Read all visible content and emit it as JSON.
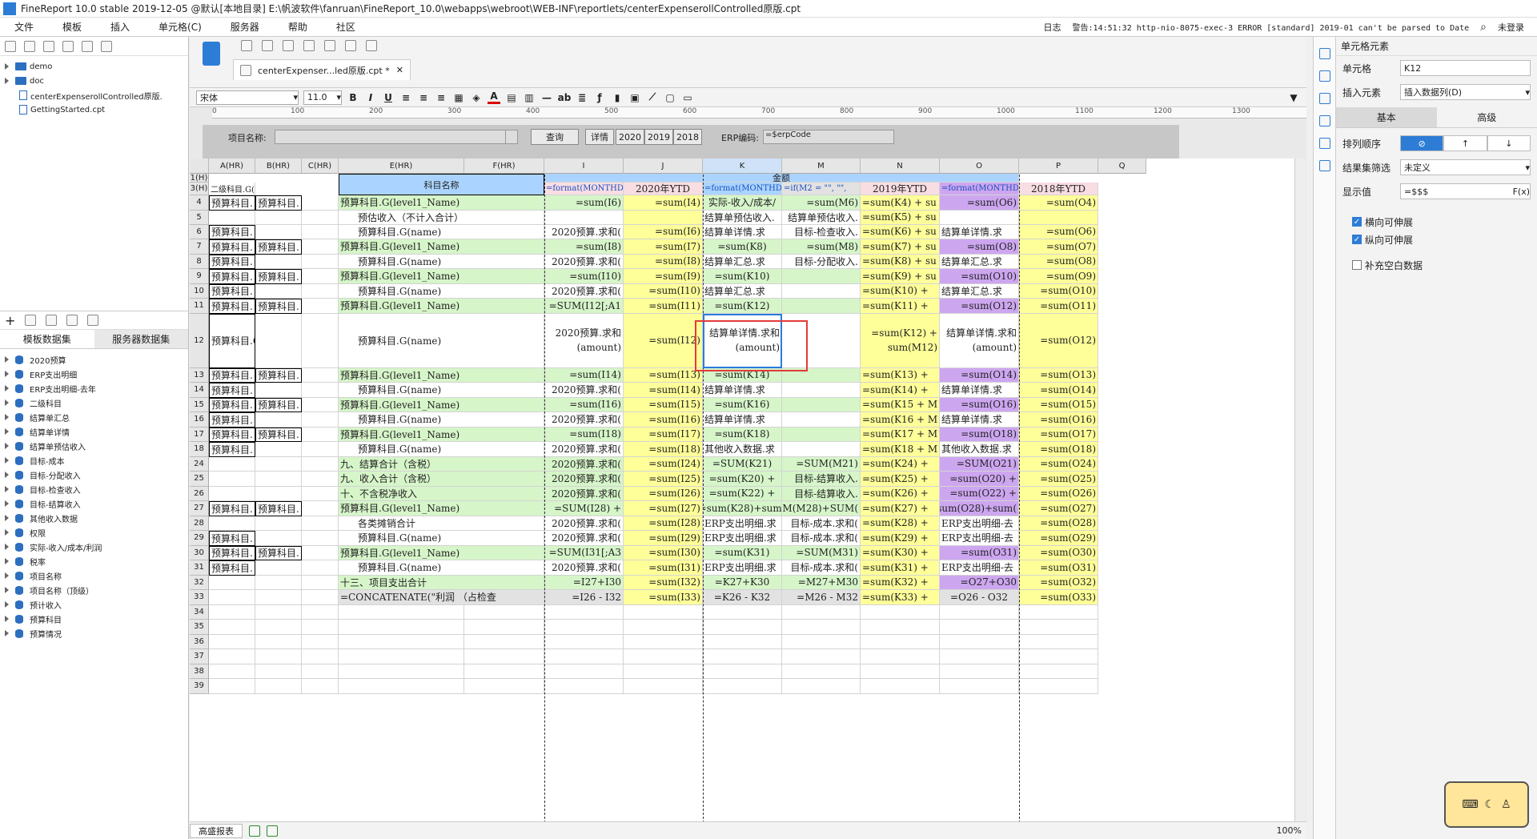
{
  "titlebar": {
    "title": "FineReport 10.0 stable 2019-12-05 @默认[本地目录]   E:\\帆波软件\\fanruan\\FineReport_10.0\\webapps\\webroot\\WEB-INF\\reportlets/centerExpenserollControlled原版.cpt"
  },
  "menu": {
    "items": [
      "文件",
      "模板",
      "插入",
      "单元格(C)",
      "服务器",
      "帮助",
      "社区"
    ],
    "log_label": "日志",
    "log_text": "警告:14:51:32 http-nio-8075-exec-3 ERROR [standard] 2019-01 can't be parsed to Date",
    "login": "未登录"
  },
  "filetree": [
    {
      "label": "demo",
      "type": "folder"
    },
    {
      "label": "doc",
      "type": "folder"
    },
    {
      "label": "centerExpenserollControlled原版.",
      "type": "file"
    },
    {
      "label": "GettingStarted.cpt",
      "type": "file"
    }
  ],
  "ds_tabs": [
    "模板数据集",
    "服务器数据集"
  ],
  "datasets": [
    "2020预算",
    "ERP支出明细",
    "ERP支出明细-去年",
    "二级科目",
    "结算单汇总",
    "结算单详情",
    "结算单预估收入",
    "目标-成本",
    "目标-分配收入",
    "目标-检查收入",
    "目标-结算收入",
    "其他收入数据",
    "权限",
    "实际-收入/成本/利润",
    "税率",
    "项目名称",
    "项目名称（顶级）",
    "预计收入",
    "预算科目",
    "预算情况"
  ],
  "doc_tab": "centerExpenser...led原版.cpt *",
  "format": {
    "font": "宋体",
    "size": "11.0"
  },
  "ruler": [
    "0",
    "100",
    "200",
    "300",
    "400",
    "500",
    "600",
    "700",
    "800",
    "900",
    "1000",
    "1100",
    "1200",
    "1300"
  ],
  "param": {
    "name_label": "项目名称:",
    "query": "查询",
    "detail": "详情",
    "y2020": "2020",
    "y2019": "2019",
    "y2018": "2018",
    "erp_label": "ERP编码:",
    "erp_value": "=$erpCode"
  },
  "columns": [
    "A(HR)",
    "B(HR)",
    "C(HR)",
    "E(HR)",
    "F(HR)",
    "I",
    "J",
    "K",
    "M",
    "N",
    "O",
    "P",
    "Q"
  ],
  "rows": [
    "1(H)",
    "3(H)",
    "4",
    "5",
    "6",
    "7",
    "8",
    "9",
    "10",
    "11",
    "12",
    "13",
    "14",
    "15",
    "16",
    "17",
    "18",
    "24",
    "25",
    "26",
    "27",
    "28",
    "29",
    "30",
    "31",
    "32",
    "33",
    "34",
    "35",
    "36",
    "37",
    "38",
    "39"
  ],
  "header": {
    "amount": "金额",
    "project": "科目名称",
    "ytd2020": "2020年YTD",
    "ytd2019": "2019年YTD",
    "ytd2018": "2018年YTD",
    "a3": "二级科目.G(",
    "i3": "=format(MONTHDELTA(",
    "k3": "=format(MONTHDELTA(",
    "m3": "=if(M2 = \"\", \"\",",
    "o3": "=format(MONTHDELTA("
  },
  "cells": {
    "4": [
      "预算科目.",
      "预算科目.",
      "",
      "预算科目.G(level1_Name)",
      "=sum(I6)",
      "=sum(I4)",
      "实际-收入/成本/",
      "=sum(M6)",
      "=sum(K4) + su",
      "=sum(O6)",
      "=sum(O4)"
    ],
    "5": [
      "",
      "",
      "",
      "预估收入（不计入合计）",
      "",
      "",
      "结算单预估收入.",
      "结算单预估收入.",
      "=sum(K5) + su",
      "",
      ""
    ],
    "6": [
      "预算科目.",
      "",
      "",
      "预算科目.G(name)",
      "2020预算.求和(",
      "=sum(I6)",
      "结算单详情.求",
      "目标-检查收入.",
      "=sum(K6) + su",
      "结算单详情.求",
      "=sum(O6)"
    ],
    "7": [
      "预算科目.",
      "预算科目.",
      "",
      "预算科目.G(level1_Name)",
      "=sum(I8)",
      "=sum(I7)",
      "=sum(K8)",
      "=sum(M8)",
      "=sum(K7) + su",
      "=sum(O8)",
      "=sum(O7)"
    ],
    "8": [
      "预算科目.",
      "",
      "",
      "预算科目.G(name)",
      "2020预算.求和(",
      "=sum(I8)",
      "结算单汇总.求",
      "目标-分配收入.",
      "=sum(K8) + su",
      "结算单汇总.求",
      "=sum(O8)"
    ],
    "9": [
      "预算科目.",
      "预算科目.",
      "",
      "预算科目.G(level1_Name)",
      "=sum(I10)",
      "=sum(I9)",
      "=sum(K10)",
      "",
      "=sum(K9) + su",
      "=sum(O10)",
      "=sum(O9)"
    ],
    "10": [
      "预算科目.",
      "",
      "",
      "预算科目.G(name)",
      "2020预算.求和(",
      "=sum(I10)",
      "结算单汇总.求",
      "",
      "=sum(K10) +",
      "结算单汇总.求",
      "=sum(O10)"
    ],
    "11": [
      "预算科目.",
      "预算科目.",
      "",
      "预算科目.G(level1_Name)",
      "=SUM(I12[;A1",
      "=sum(I11)",
      "=sum(K12)",
      "",
      "=sum(K11) +",
      "=sum(O12)",
      "=sum(O11)"
    ],
    "12": [
      "预算科目.G(id)",
      "",
      "",
      "预算科目.G(name)",
      "2020预算.求和(amount)",
      "=sum(I12)",
      "结算单详情.求和(amount)",
      "",
      "=sum(K12) + sum(M12)",
      "结算单详情.求和(amount)",
      "=sum(O12)"
    ],
    "13": [
      "预算科目.",
      "预算科目.",
      "",
      "预算科目.G(level1_Name)",
      "=sum(I14)",
      "=sum(I13)",
      "=sum(K14)",
      "",
      "=sum(K13) +",
      "=sum(O14)",
      "=sum(O13)"
    ],
    "14": [
      "预算科目.",
      "",
      "",
      "预算科目.G(name)",
      "2020预算.求和(",
      "=sum(I14)",
      "结算单详情.求",
      "",
      "=sum(K14) +",
      "结算单详情.求",
      "=sum(O14)"
    ],
    "15": [
      "预算科目.",
      "预算科目.",
      "",
      "预算科目.G(level1_Name)",
      "=sum(I16)",
      "=sum(I15)",
      "=sum(K16)",
      "",
      "=sum(K15 + M15",
      "=sum(O16)",
      "=sum(O15)"
    ],
    "16": [
      "预算科目.",
      "",
      "",
      "预算科目.G(name)",
      "2020预算.求和(",
      "=sum(I16)",
      "结算单详情.求",
      "",
      "=sum(K16 + M16",
      "结算单详情.求",
      "=sum(O16)"
    ],
    "17": [
      "预算科目.",
      "预算科目.",
      "",
      "预算科目.G(level1_Name)",
      "=sum(I18)",
      "=sum(I17)",
      "=sum(K18)",
      "",
      "=sum(K17 + M17",
      "=sum(O18)",
      "=sum(O17)"
    ],
    "18": [
      "预算科目.",
      "",
      "",
      "预算科目.G(name)",
      "2020预算.求和(",
      "=sum(I18)",
      "其他收入数据.求",
      "",
      "=sum(K18 + M18",
      "其他收入数据.求",
      "=sum(O18)"
    ],
    "24": [
      "",
      "",
      "",
      "九、结算合计（含税）",
      "2020预算.求和(",
      "=sum(I24)",
      "=SUM(K21)",
      "=SUM(M21)",
      "=sum(K24) +",
      "=SUM(O21)",
      "=sum(O24)"
    ],
    "25": [
      "",
      "",
      "",
      "九、收入合计（含税）",
      "2020预算.求和(",
      "=sum(I25)",
      "=sum(K20) +",
      "目标-结算收入.",
      "=sum(K25) +",
      "=sum(O20) +",
      "=sum(O25)"
    ],
    "26": [
      "",
      "",
      "",
      "十、不含税净收入",
      "2020预算.求和(",
      "=sum(I26)",
      "=sum(K22) +",
      "目标-结算收入.",
      "=sum(K26) +",
      "=sum(O22) +",
      "=sum(O26)"
    ],
    "27": [
      "预算科目.",
      "预算科目.",
      "",
      "预算科目.G(level1_Name)",
      "=SUM(I28) +",
      "=sum(I27)",
      "=sum(K28)+sum(",
      "=SUM(M28)+SUM(",
      "=sum(K27) +",
      "=sum(O28)+sum(",
      "=sum(O27)"
    ],
    "28": [
      "",
      "",
      "",
      "各类摊销合计",
      "2020预算.求和(",
      "=sum(I28)",
      "ERP支出明细.求",
      "目标-成本.求和(",
      "=sum(K28) +",
      "ERP支出明细-去",
      "=sum(O28)"
    ],
    "29": [
      "预算科目.",
      "",
      "",
      "预算科目.G(name)",
      "2020预算.求和(",
      "=sum(I29)",
      "ERP支出明细.求",
      "目标-成本.求和(",
      "=sum(K29) +",
      "ERP支出明细-去",
      "=sum(O29)"
    ],
    "30": [
      "预算科目.",
      "预算科目.",
      "",
      "预算科目.G(level1_Name)",
      "=SUM(I31[;A3",
      "=sum(I30)",
      "=sum(K31)",
      "=SUM(M31)",
      "=sum(K30) +",
      "=sum(O31)",
      "=sum(O30)"
    ],
    "31": [
      "预算科目.",
      "",
      "",
      "预算科目.G(name)",
      "2020预算.求和(",
      "=sum(I31)",
      "ERP支出明细.求",
      "目标-成本.求和(",
      "=sum(K31) +",
      "ERP支出明细-去",
      "=sum(O31)"
    ],
    "32": [
      "",
      "",
      "",
      "十三、项目支出合计",
      "=I27+I30",
      "=sum(I32)",
      "=K27+K30",
      "=M27+M30",
      "=sum(K32) +",
      "=O27+O30",
      "=sum(O32)"
    ],
    "33": [
      "",
      "",
      "",
      "=CONCATENATE(\"利润 （占检查",
      "=I26 - I32",
      "=sum(I33)",
      "=K26 - K32",
      "=M26 - M32",
      "=sum(K33) +",
      "=O26 - O32",
      "=sum(O33)"
    ]
  },
  "status": {
    "sheet": "高盛报表",
    "zoom": "100%"
  },
  "panel": {
    "title": "单元格元素",
    "cell_label": "单元格",
    "cell_value": "K12",
    "insert_label": "插入元素",
    "insert_value": "插入数据列(D)",
    "tab_basic": "基本",
    "tab_adv": "高级",
    "sort_label": "排列顺序",
    "filter_label": "结果集筛选",
    "filter_value": "未定义",
    "display_label": "显示值",
    "display_value": "=$$$",
    "fx": "F(x)",
    "h_expand": "横向可伸展",
    "v_expand": "纵向可伸展",
    "fill_blank": "补充空白数据"
  }
}
